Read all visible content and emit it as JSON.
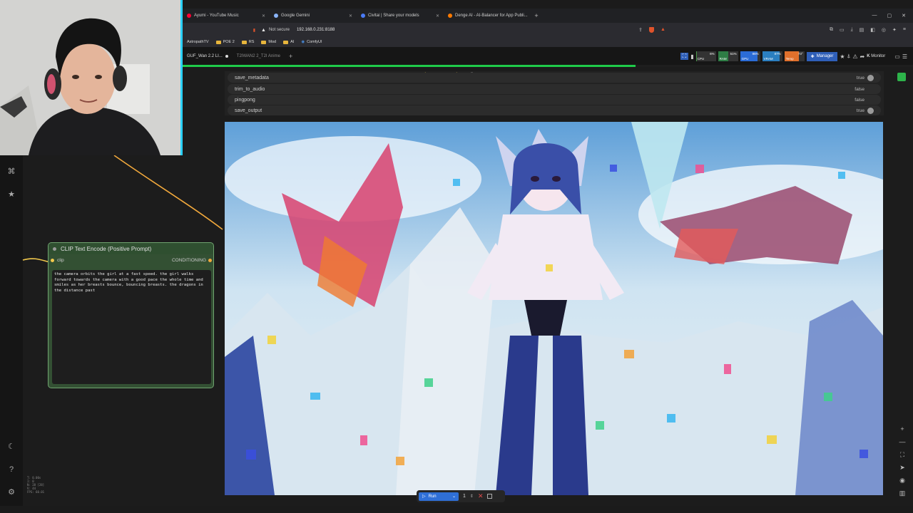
{
  "browser": {
    "tabs": [
      {
        "label": "Ayumi - YouTube Music",
        "color": "#ff0033"
      },
      {
        "label": "Google Gemini",
        "color": "#8ab4f8"
      },
      {
        "label": "Civitai | Share your models",
        "color": "#4a7bf7"
      },
      {
        "label": "Denge AI - AI-Balancer for App Publi...",
        "color": "#ff7a00"
      }
    ],
    "not_secure": "Not secure",
    "url": "192.168.0.231:8188",
    "bookmarks": [
      "AstropathTV",
      "POE 2",
      "RS",
      "Mod",
      "AI",
      "ComfyUI"
    ]
  },
  "comfy": {
    "workflow_tabs": [
      "GUF_Wan 2.2 LI...",
      "T2IWAN2 2_T2I Anime"
    ],
    "monitors": [
      {
        "label": "CPU",
        "value": "6%",
        "color": "#4c9a4c",
        "level": 0.06
      },
      {
        "label": "RAM",
        "value": "51%",
        "color": "#2e7d45",
        "level": 0.51
      },
      {
        "label": "GPU",
        "value": "86%",
        "color": "#2b6cd6",
        "level": 0.86
      },
      {
        "label": "VRAM",
        "value": "87%",
        "color": "#2b7fc0",
        "level": 0.87
      },
      {
        "label": "Temp",
        "value": "73°",
        "color": "#e0702c",
        "level": 0.73
      }
    ],
    "manager_label": "Manager",
    "monitor_label": "Monitor",
    "progress": 0.62
  },
  "widgets": [
    {
      "name": "save_metadata",
      "value": "true"
    },
    {
      "name": "trim_to_audio",
      "value": "false"
    },
    {
      "name": "pingpong",
      "value": "false"
    },
    {
      "name": "save_output",
      "value": "true"
    }
  ],
  "node": {
    "title": "CLIP Text Encode (Positive Prompt)",
    "input_label": "clip",
    "output_label": "CONDITIONING",
    "prompt": "the camera orbits the girl at a fast speed. the girl walks forward towards the camera with a good pace the whole time and smiles as her breasts bounce, bouncing breasts. the dragons in the distance past"
  },
  "run": {
    "label": "Run",
    "count": "1"
  },
  "stats_text": "T: 0.00s\nI: 0\nN: 28 [28]\nV: 44\nFPS: 60.01"
}
